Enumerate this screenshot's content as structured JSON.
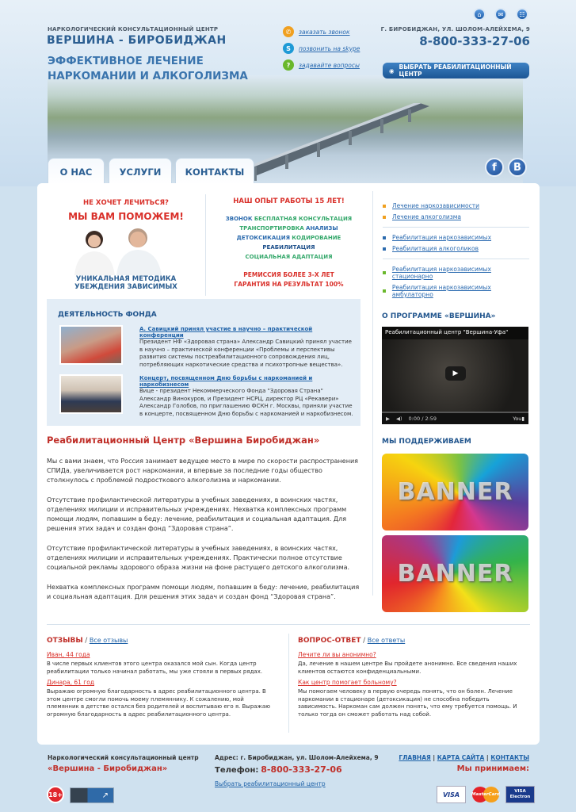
{
  "header": {
    "tagline": "НАРКОЛОГИЧЕСКИЙ КОНСУЛЬТАЦИОННЫЙ ЦЕНТР",
    "brand": "ВЕРШИНА - БИРОБИДЖАН",
    "slogan_line1": "ЭФФЕКТИВНОЕ ЛЕЧЕНИЕ",
    "slogan_line2": "НАРКОМАНИИ И АЛКОГОЛИЗМА",
    "links": [
      {
        "icon": "phone-icon",
        "label": "заказать звонок",
        "color": "#f0a020"
      },
      {
        "icon": "skype-icon",
        "label": "позвонить на skype",
        "color": "#1e9ad6"
      },
      {
        "icon": "question-icon",
        "label": "задавайте вопросы",
        "color": "#6ab82c"
      }
    ],
    "address": "Г. БИРОБИДЖАН, УЛ. ШОЛОМ-АЛЕЙХЕМА, 9",
    "phone": "8-800-333-27-06",
    "select_button": "ВЫБРАТЬ РЕАБИЛИТАЦИОННЫЙ ЦЕНТР",
    "top_icons": [
      "home-icon",
      "mail-icon",
      "sitemap-icon"
    ]
  },
  "nav": {
    "tabs": [
      "О НАС",
      "УСЛУГИ",
      "КОНТАКТЫ"
    ],
    "social": [
      "f",
      "B"
    ]
  },
  "promo": {
    "line1": "НЕ ХОЧЕТ ЛЕЧИТЬСЯ?",
    "line2": "МЫ ВАМ ПОМОЖЕМ!",
    "caption1": "УНИКАЛЬНАЯ МЕТОДИКА",
    "caption2": "УБЕЖДЕНИЯ ЗАВИСИМЫХ"
  },
  "experience": {
    "title": "НАШ ОПЫТ РАБОТЫ 15 ЛЕТ!",
    "r1a": "ЗВОНОК",
    "r1b": "БЕСПЛАТНАЯ КОНСУЛЬТАЦИЯ",
    "r2a": "ТРАНСПОРТИРОВКА",
    "r2b": "АНАЛИЗЫ",
    "r3a": "ДЕТОКСИКАЦИЯ",
    "r3b": "КОДИРОВАНИЕ",
    "r4": "РЕАБИЛИТАЦИЯ",
    "r5": "СОЦИАЛЬНАЯ АДАПТАЦИЯ",
    "r6": "РЕМИССИЯ БОЛЕЕ 3-Х ЛЕТ",
    "r7": "ГАРАНТИЯ НА РЕЗУЛЬТАТ 100%"
  },
  "sidebar_links": [
    {
      "label": "Лечение наркозависимости",
      "color": "#f0a020"
    },
    {
      "label": "Лечение алкоголизма",
      "color": "#f0a020"
    },
    {
      "label": "Реабилитация наркозависимых",
      "color": "#2c6bae"
    },
    {
      "label": "Реабилитация алкоголиков",
      "color": "#2c6bae"
    },
    {
      "label": "Реабилитация наркозависимых стационарно",
      "color": "#6ab82c"
    },
    {
      "label": "Реабилитация наркозависимых амбулаторно",
      "color": "#6ab82c"
    }
  ],
  "fund": {
    "title": "ДЕЯТЕЛЬНОСТЬ ФОНДА",
    "items": [
      {
        "title": "А. Савицкий принял участие в научно – практической конференции",
        "text": "Президент НФ «Здоровая страна» Александр Савицкий принял участие в научно – практической конференции «Проблемы и перспективы развития системы постреабилитационного сопровождения лиц, потребляющих наркотические средства и психотропные вещества»."
      },
      {
        "title": "Концерт, посвященном Дню борьбы с наркоманией и наркобизнесом",
        "text": "Вице - президент Некоммерческого Фонда \"Здоровая Страна\" Александр Винокуров, и Президент НСРЦ, директор РЦ «Рекавери» Александр Голобов, по приглашению ФСКН г. Москвы, приняли участие в концерте, посвященном Дню борьбы с наркоманией и наркобизнесом."
      }
    ]
  },
  "program": {
    "title": "О ПРОГРАММЕ «ВЕРШИНА»",
    "video_title": "Реабилитационный центр \"Вершина-Уфа\"",
    "time": "0:00 / 2:59"
  },
  "support": {
    "title": "МЫ ПОДДЕРЖИВАЕМ",
    "banners": [
      "BANNER",
      "BANNER"
    ]
  },
  "article": {
    "title": "Реабилитационный Центр «Вершина Биробиджан»",
    "paragraphs": [
      "Мы с вами знаем, что Россия занимает ведущее место в мире по скорости распространения СПИДа, увеличивается рост наркомании, и впервые за последние годы общество столкнулось с проблемой подросткового алкоголизма и наркомании.",
      "Отсутствие профилактической литературы в учебных заведениях, в воинских частях, отделениях милиции и исправительных учреждениях. Нехватка комплексных программ помощи людям, попавшим в беду: лечение, реабилитация и социальная адаптация. Для решения этих задач и создан фонд “Здоровая страна”.",
      "Отсутствие профилактической литературы в учебных заведениях, в воинских частях, отделениях милиции и исправительных учреждениях. Практически полное отсутствие социальной рекламы здорового образа жизни на фоне растущего детского алкоголизма.",
      "Нехватка комплексных программ помощи людям, попавшим в беду: лечение, реабилитация и социальная адаптация. Для решения этих задач и создан фонд “Здоровая страна”."
    ]
  },
  "reviews": {
    "title": "ОТЗЫВЫ",
    "all": "Все отзывы",
    "items": [
      {
        "name": "Иван, 44 года",
        "text": "В числе первых клиентов этого центра оказался мой сын. Когда центр реабилитации только начинал работать, мы уже стояли в первых рядах."
      },
      {
        "name": "Динара, 61 год",
        "text": "Выражаю огромную благодарность в адрес реабилитационного центра. В этом центре смогли помочь моему племяннику. К сожалению, мой племянник в детстве остался без родителей и воспитываю его я. Выражаю огромную благодарность в адрес реабилитационного центра."
      }
    ]
  },
  "qa": {
    "title": "ВОПРОС-ОТВЕТ",
    "all": "Все ответы",
    "items": [
      {
        "q": "Лечите ли вы анонимно?",
        "a": "Да, лечение в нашем центре Вы пройдете анонимно. Все сведения наших клиентов остаются конфиденциальными."
      },
      {
        "q": "Как центр помогает больному?",
        "a": "Мы помогаем человеку в первую очередь понять, что он болен. Лечение наркомании в стационаре (детоксикация) не способна победить зависимость. Наркоман сам должен понять, что ему требуется помощь. И только тогда он сможет работать над собой."
      }
    ]
  },
  "footer": {
    "org": "Наркологический консультационный центр",
    "brand": "«Вершина - Биробиджан»",
    "age": "18+",
    "address": "Адрес: г. Биробиджан, ул. Шолом-Алейхема, 9",
    "phone_label": "Телефон:",
    "phone": "8-800-333-27-06",
    "select_link": "Выбрать реабилитационный центр",
    "nav": [
      "ГЛАВНАЯ",
      "КАРТА САЙТА",
      "КОНТАКТЫ"
    ],
    "accept": "Мы принимаем:",
    "cards": [
      "VISA",
      "MasterCard",
      "VISA Electron"
    ]
  }
}
